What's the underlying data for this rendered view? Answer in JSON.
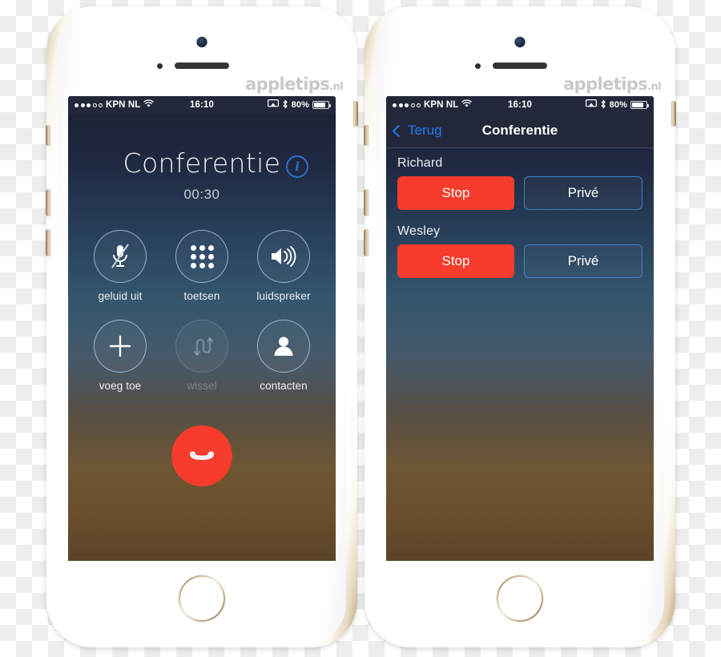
{
  "watermark": {
    "name": "appletips",
    "tld": ".nl"
  },
  "status_bar": {
    "signal_filled": 3,
    "signal_hollow": 2,
    "carrier": "KPN NL",
    "wifi_icon": "wifi-icon",
    "time": "16:10",
    "airplay_icon": "airplay-icon",
    "bluetooth_icon": "bluetooth-icon",
    "battery_percent": "80%",
    "battery_level": 80
  },
  "call_screen": {
    "title": "Conferentie",
    "info_button_label": "i",
    "timer": "00:30",
    "buttons": [
      {
        "label": "geluid uit",
        "icon": "mic-off-icon",
        "disabled": false
      },
      {
        "label": "toetsen",
        "icon": "keypad-icon",
        "disabled": false
      },
      {
        "label": "luidspreker",
        "icon": "speaker-icon",
        "disabled": false
      },
      {
        "label": "voeg toe",
        "icon": "plus-icon",
        "disabled": false
      },
      {
        "label": "wissel",
        "icon": "swap-icon",
        "disabled": true
      },
      {
        "label": "contacten",
        "icon": "person-icon",
        "disabled": false
      }
    ],
    "end_call_icon": "end-call-handset-icon"
  },
  "conference_screen": {
    "back_label": "Terug",
    "title": "Conferentie",
    "participants": [
      {
        "name": "Richard",
        "stop_label": "Stop",
        "private_label": "Privé"
      },
      {
        "name": "Wesley",
        "stop_label": "Stop",
        "private_label": "Privé"
      }
    ]
  },
  "colors": {
    "accent_blue": "#1f7cf0",
    "red": "#f63c2c",
    "border_blue": "#3f7fc4",
    "statusbar_bg": "#22283a"
  }
}
